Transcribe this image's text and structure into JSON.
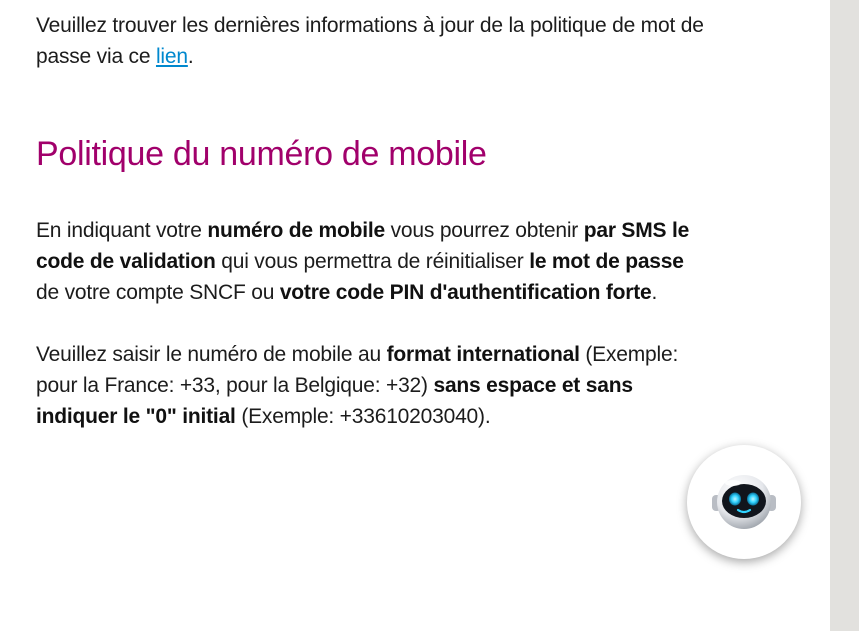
{
  "intro": {
    "text_before": "Veuillez trouver les dernières informations à jour de la politique de mot de passe via ce ",
    "link_label": "lien",
    "text_after": "."
  },
  "section": {
    "title": "Politique du numéro de mobile"
  },
  "paragraph1": {
    "t1": "En indiquant votre ",
    "b1": "numéro de mobile",
    "t2": " vous pourrez obtenir ",
    "b2": "par SMS le code de validation",
    "t3": " qui vous permettra de réinitialiser ",
    "b3": "le mot de passe",
    "t4": " de votre compte SNCF ou ",
    "b4": "votre code PIN d'authentification forte",
    "t5": "."
  },
  "paragraph2": {
    "t1": "Veuillez saisir le numéro de mobile au ",
    "b1": "format international",
    "t2": " (Exemple: pour la France: +33, pour la Belgique: +32) ",
    "b2": "sans espace et sans indiquer le \"0\" initial",
    "t3": " (Exemple: +33610203040)."
  },
  "chatbot": {
    "icon": "robot-icon",
    "accent": "#2fd3ff"
  },
  "colors": {
    "title": "#a1006b",
    "link": "#0088ce",
    "scrollbar": "#e2e1de"
  }
}
